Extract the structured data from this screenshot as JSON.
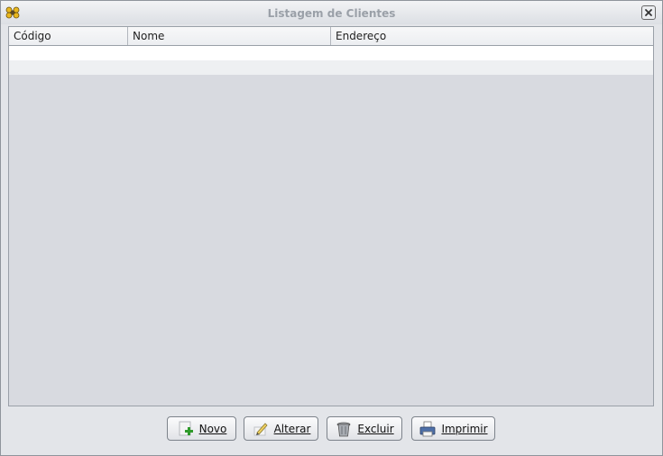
{
  "window": {
    "title": "Listagem de Clientes",
    "app_icon": "flower-icon",
    "close_icon": "close-icon"
  },
  "table": {
    "columns": [
      "Código",
      "Nome",
      "Endereço"
    ],
    "rows": []
  },
  "buttons": {
    "novo": {
      "label": "Novo",
      "icon": "add-document-icon"
    },
    "alterar": {
      "label": "Alterar",
      "icon": "edit-pencil-icon"
    },
    "excluir": {
      "label": "Excluir",
      "icon": "trash-can-icon"
    },
    "imprimir": {
      "label": "Imprimir",
      "icon": "printer-icon"
    }
  },
  "colors": {
    "title_text": "#9aa0a8",
    "table_background": "#d8dae0",
    "window_background": "#e3e5e9"
  }
}
